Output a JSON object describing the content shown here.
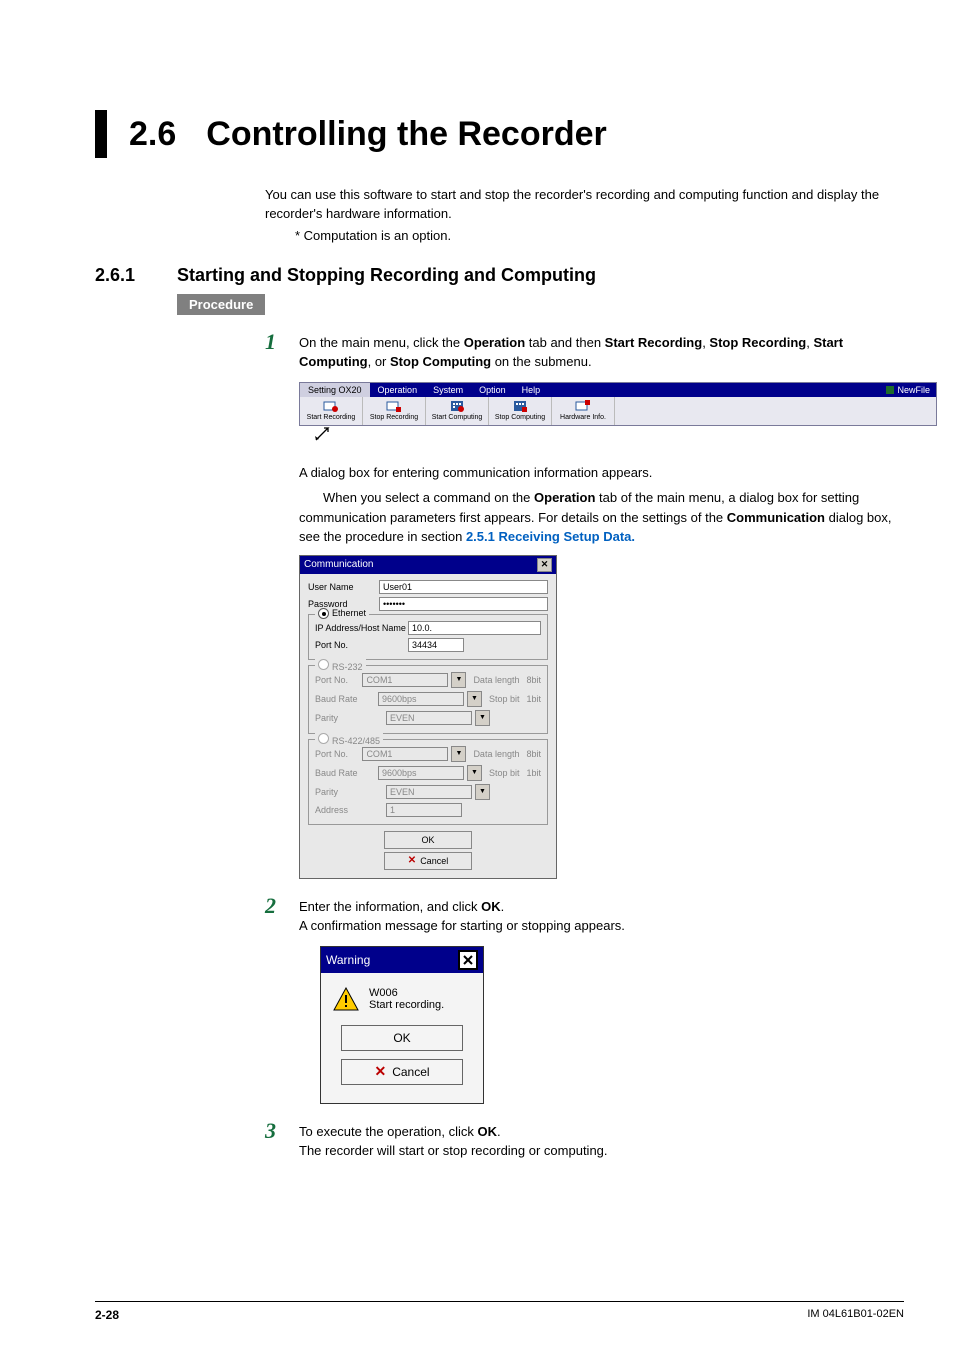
{
  "h1": {
    "num": "2.6",
    "title": "Controlling the Recorder"
  },
  "intro": "You can use this software to start and stop the recorder's recording and computing function and display the recorder's hardware information.",
  "footnote": "*   Computation is an option.",
  "h2": {
    "num": "2.6.1",
    "title": "Starting and Stopping Recording and Computing"
  },
  "procedure_label": "Procedure",
  "step1": {
    "num": "1",
    "pre": "On the main menu, click the ",
    "b1": "Operation",
    "mid1": " tab and then ",
    "b2": "Start Recording",
    "mid2": ", ",
    "b3": "Stop Recording",
    "mid3": ", ",
    "b4": "Start Computing",
    "mid4": ", or ",
    "b5": "Stop Computing",
    "post": " on the submenu."
  },
  "menubar": {
    "tabs": [
      "Setting OX20",
      "Operation",
      "System",
      "Option",
      "Help"
    ],
    "newfile": "NewFile",
    "toolbar": [
      "Start Recording",
      "Stop Recording",
      "Start Computing",
      "Stop Computing",
      "Hardware Info."
    ]
  },
  "step1_after": "A dialog box for entering communication information appears.",
  "step1_after2": {
    "t1": "When you select a command on the ",
    "b1": "Operation",
    "t2": " tab of the main menu, a dialog box for setting communication parameters first appears. For details on the settings of the ",
    "b2": "Communication",
    "t3": " dialog box, see the procedure in section ",
    "link": "2.5.1 Receiving Setup Data."
  },
  "comm": {
    "title": "Communication",
    "user_label": "User Name",
    "user": "User01",
    "pw_label": "Password",
    "pw": "•••••••",
    "eth": {
      "label": "Ethernet",
      "ip_label": "IP Address/Host Name",
      "ip": "10.0.",
      "port_label": "Port No.",
      "port": "34434"
    },
    "rs232": {
      "label": "RS-232",
      "port_label": "Port No.",
      "port": "COM1",
      "data_label": "Data length",
      "data": "8bit",
      "baud_label": "Baud Rate",
      "baud": "9600bps",
      "stop_label": "Stop bit",
      "stop": "1bit",
      "parity_label": "Parity",
      "parity": "EVEN"
    },
    "rs485": {
      "label": "RS-422/485",
      "port_label": "Port No.",
      "port": "COM1",
      "data_label": "Data length",
      "data": "8bit",
      "baud_label": "Baud Rate",
      "baud": "9600bps",
      "stop_label": "Stop bit",
      "stop": "1bit",
      "parity_label": "Parity",
      "parity": "EVEN",
      "addr_label": "Address",
      "addr": "1"
    },
    "ok": "OK",
    "cancel": "Cancel"
  },
  "step2": {
    "num": "2",
    "pre": "Enter the information, and click ",
    "b1": "OK",
    "post": ".",
    "line2": "A confirmation message for starting or stopping appears."
  },
  "warn": {
    "title": "Warning",
    "code": "W006",
    "msg": "Start recording.",
    "ok": "OK",
    "cancel": "Cancel"
  },
  "step3": {
    "num": "3",
    "pre": "To execute the operation, click ",
    "b1": "OK",
    "post": ".",
    "line2": "The recorder will start or stop recording or computing."
  },
  "footer": {
    "page": "2-28",
    "docid": "IM 04L61B01-02EN"
  }
}
